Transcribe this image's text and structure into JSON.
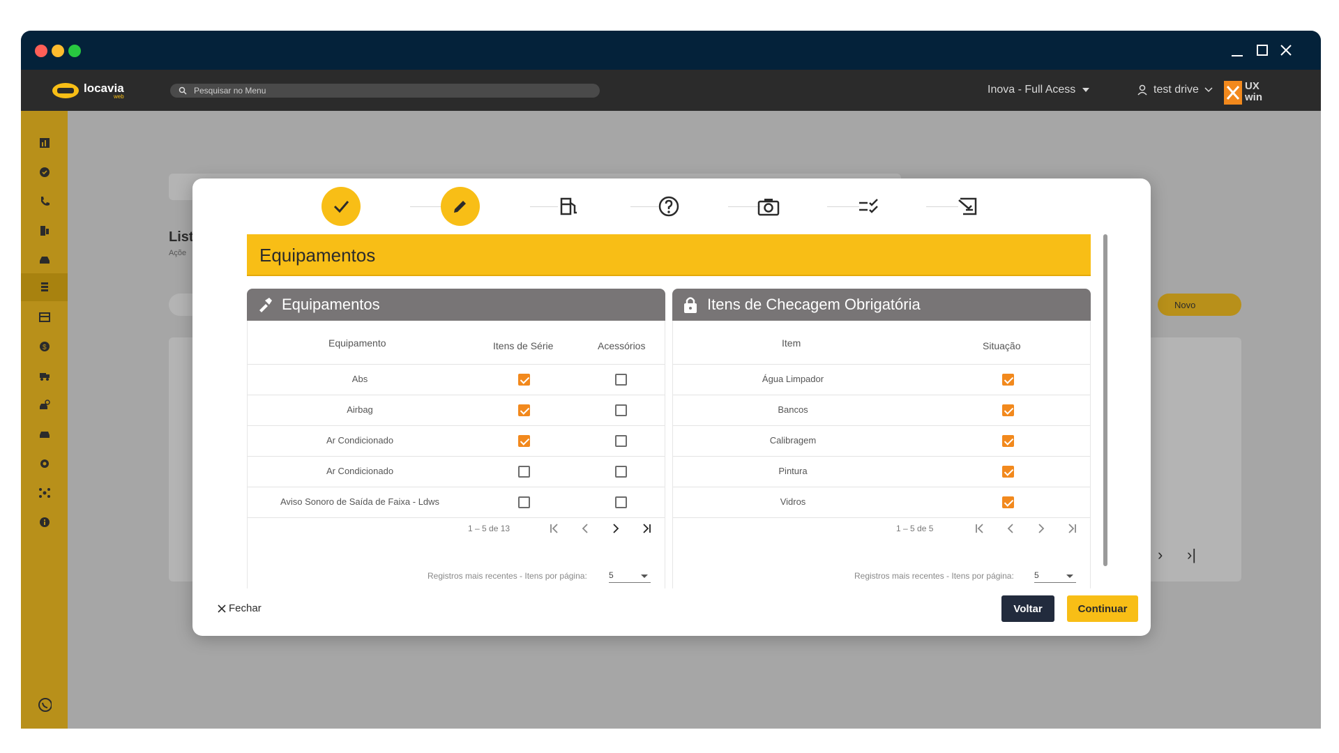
{
  "topbar": {
    "search_placeholder": "Pesquisar no Menu",
    "logo_text": "locavia",
    "logo_sub": "web",
    "tenant": "Inova - Full Acess",
    "user": "test drive",
    "brand": "UX win"
  },
  "background": {
    "list_title": "List",
    "list_sub": "Açõe",
    "new_button": "Novo"
  },
  "modal": {
    "section_title": "Equipamentos",
    "equipment_panel": {
      "title": "Equipamentos",
      "col_equipment": "Equipamento",
      "col_series": "Itens de Série",
      "col_accessories": "Acessórios",
      "rows": [
        {
          "name": "Abs",
          "series": true,
          "accessory": false
        },
        {
          "name": "Airbag",
          "series": true,
          "accessory": false
        },
        {
          "name": "Ar Condicionado",
          "series": true,
          "accessory": false
        },
        {
          "name": "Ar Condicionado",
          "series": false,
          "accessory": false
        },
        {
          "name": "Aviso Sonoro de Saída de Faixa - Ldws",
          "series": false,
          "accessory": false
        }
      ],
      "range": "1 – 5 de 13",
      "footer_label": "Registros mais recentes - Itens por página:",
      "per_page": "5"
    },
    "checklist_panel": {
      "title": "Itens de Checagem Obrigatória",
      "col_item": "Item",
      "col_status": "Situação",
      "rows": [
        {
          "name": "Água Limpador",
          "status": true
        },
        {
          "name": "Bancos",
          "status": true
        },
        {
          "name": "Calibragem",
          "status": true
        },
        {
          "name": "Pintura",
          "status": true
        },
        {
          "name": "Vidros",
          "status": true
        }
      ],
      "range": "1 – 5 de 5",
      "footer_label": "Registros mais recentes - Itens por página:",
      "per_page": "5"
    },
    "close_label": "Fechar",
    "back_label": "Voltar",
    "continue_label": "Continuar"
  },
  "colors": {
    "accent": "#f8be16",
    "dark": "#222b3d",
    "checkbox_on": "#f2891d",
    "panel_head": "#787576"
  }
}
